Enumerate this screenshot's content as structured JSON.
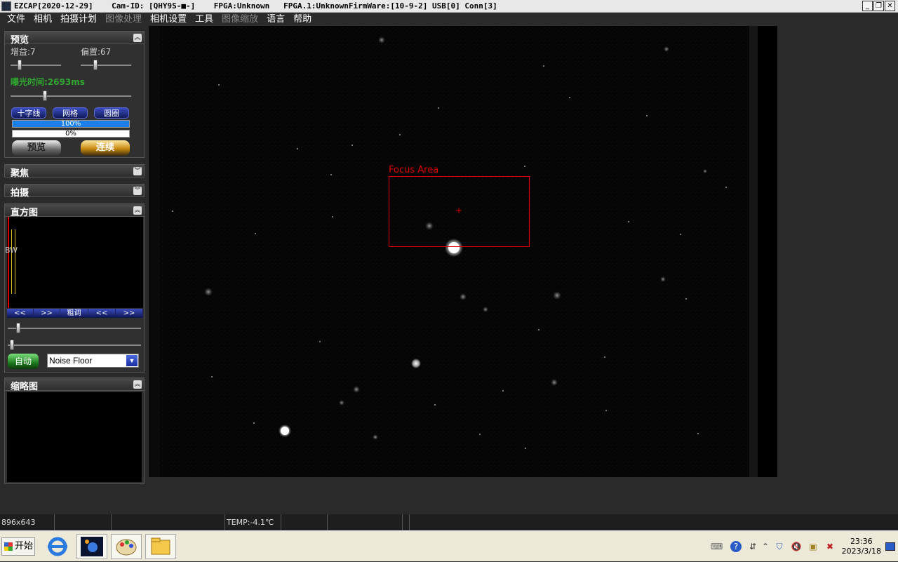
{
  "window": {
    "title": "EZCAP[2020-12-29]    Cam-ID: [QHY9S-■-]    FPGA:Unknown   FPGA.1:UnknownFirmWare:[10-9-2] USB[0] Conn[3]",
    "controls": [
      "_",
      "❐",
      "✕"
    ]
  },
  "menu": [
    {
      "label": "文件",
      "enabled": true
    },
    {
      "label": "相机",
      "enabled": true
    },
    {
      "label": "拍摄计划",
      "enabled": true
    },
    {
      "label": "图像处理",
      "enabled": false
    },
    {
      "label": "相机设置",
      "enabled": true
    },
    {
      "label": "工具",
      "enabled": true
    },
    {
      "label": "图像缩放",
      "enabled": false
    },
    {
      "label": "语言",
      "enabled": true
    },
    {
      "label": "帮助",
      "enabled": true
    }
  ],
  "preview": {
    "title": "预览",
    "gain_label": "增益:7",
    "offset_label": "偏置:67",
    "exposure_label": "曝光时间:2693ms",
    "exposure_color": "#2ea82e",
    "buttons": [
      "十字线",
      "网格",
      "圆圈"
    ],
    "progress1": "100%",
    "progress2": "0%",
    "preview_button": "预览",
    "continuous_button": "连续"
  },
  "focus": {
    "title": "聚焦"
  },
  "capture": {
    "title": "拍摄"
  },
  "histogram": {
    "title": "直方图",
    "channel": "BW",
    "nav": [
      "<<",
      ">>",
      "粗调",
      "<<",
      ">>"
    ],
    "auto_button": "自动",
    "mode_select": "Noise Floor"
  },
  "thumbnail": {
    "title": "缩略图"
  },
  "image": {
    "focus_area_label": "Focus Area",
    "accent": "#e00000"
  },
  "status": {
    "cells": [
      "896x643",
      "",
      "",
      "TEMP:-4.1℃",
      "",
      "",
      "",
      ""
    ]
  },
  "taskbar": {
    "start": "开始",
    "clock_time": "23:36",
    "clock_date": "2023/3/18"
  }
}
